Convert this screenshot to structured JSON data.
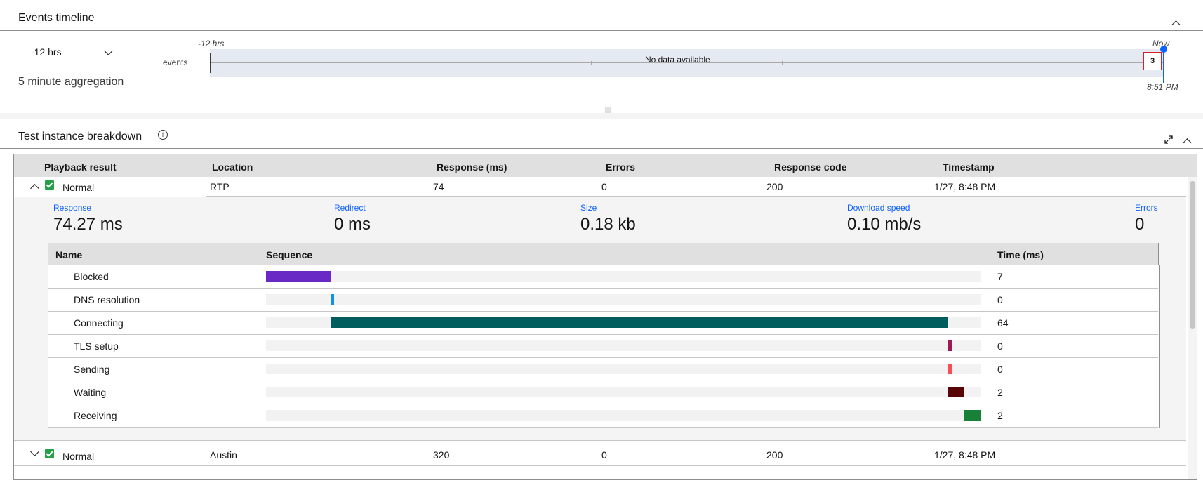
{
  "events_timeline": {
    "title": "Events timeline",
    "range_select": {
      "value": "-12 hrs"
    },
    "aggregation": "5 minute aggregation",
    "row_label": "events",
    "start_label": "-12 hrs",
    "end_label": "Now",
    "time_label": "8:51 PM",
    "empty_message": "No data available",
    "marker_count": "3"
  },
  "breakdown": {
    "title": "Test instance breakdown",
    "columns": [
      "Playback result",
      "Location",
      "Response (ms)",
      "Errors",
      "Response code",
      "Timestamp"
    ],
    "rows": [
      {
        "result": "Normal",
        "location": "RTP",
        "response": "74",
        "errors": "0",
        "code": "200",
        "timestamp": "1/27, 8:48 PM",
        "expanded": true
      },
      {
        "result": "Normal",
        "location": "Austin",
        "response": "320",
        "errors": "0",
        "code": "200",
        "timestamp": "1/27, 8:48 PM",
        "expanded": false
      }
    ],
    "detail": {
      "stats": [
        {
          "label": "Response",
          "value": "74.27 ms"
        },
        {
          "label": "Redirect",
          "value": "0 ms"
        },
        {
          "label": "Size",
          "value": "0.18 kb"
        },
        {
          "label": "Download speed",
          "value": "0.10 mb/s"
        },
        {
          "label": "Errors",
          "value": "0"
        }
      ],
      "seq_columns": [
        "Name",
        "Sequence",
        "Time (ms)"
      ],
      "phases": [
        {
          "name": "Blocked",
          "time": "7",
          "start": 0.0,
          "end": 0.09,
          "color": "#6929c4"
        },
        {
          "name": "DNS resolution",
          "time": "0",
          "start": 0.09,
          "end": 0.095,
          "color": "#1192e8"
        },
        {
          "name": "Connecting",
          "time": "64",
          "start": 0.09,
          "end": 0.955,
          "color": "#005d5d"
        },
        {
          "name": "TLS setup",
          "time": "0",
          "start": 0.955,
          "end": 0.96,
          "color": "#9f1853"
        },
        {
          "name": "Sending",
          "time": "0",
          "start": 0.955,
          "end": 0.96,
          "color": "#fa4d56"
        },
        {
          "name": "Waiting",
          "time": "2",
          "start": 0.955,
          "end": 0.976,
          "color": "#570408"
        },
        {
          "name": "Receiving",
          "time": "2",
          "start": 0.976,
          "end": 1.0,
          "color": "#198038"
        }
      ]
    }
  }
}
